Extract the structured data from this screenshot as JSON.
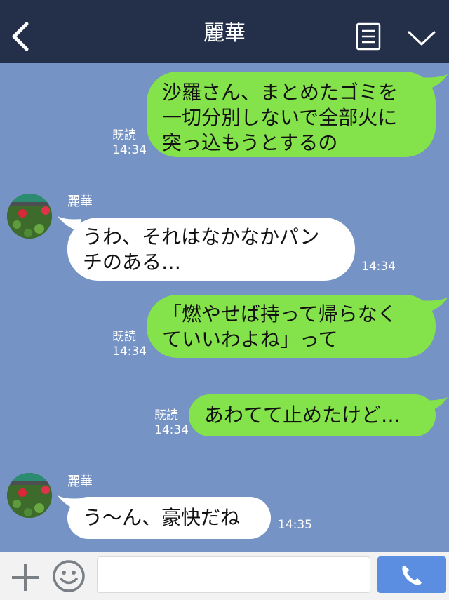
{
  "header": {
    "title": "麗華",
    "back_icon": "chevron-left-icon",
    "notes_icon": "notes-icon",
    "menu_icon": "chevron-down-icon",
    "background": "#243049"
  },
  "messages": [
    {
      "direction": "outgoing",
      "lines": [
        "沙羅さん、まとめたゴミを",
        "一切分別しないで全部火に",
        "突っ込もうとするの"
      ],
      "read": "既読",
      "time": "14:34"
    },
    {
      "direction": "incoming",
      "sender": "麗華",
      "lines": [
        "うわ、それはなかなかパン",
        "チのある…"
      ],
      "time": "14:34"
    },
    {
      "direction": "outgoing",
      "lines": [
        "「燃やせば持って帰らなく",
        "ていいわよね」って"
      ],
      "read": "既読",
      "time": "14:34"
    },
    {
      "direction": "outgoing",
      "lines": [
        "あわてて止めたけど…"
      ],
      "read": "既読",
      "time": "14:34"
    },
    {
      "direction": "incoming",
      "sender": "麗華",
      "lines": [
        "う～ん、豪快だね"
      ],
      "time": "14:35"
    }
  ],
  "input_bar": {
    "plus_icon": "plus-icon",
    "emoji_icon": "smiley-icon",
    "text_value": "",
    "call_icon": "phone-icon"
  },
  "colors": {
    "chat_background": "#7593c4",
    "outgoing_bubble": "#84e24a",
    "incoming_bubble": "#ffffff",
    "call_button": "#5b8de0"
  }
}
